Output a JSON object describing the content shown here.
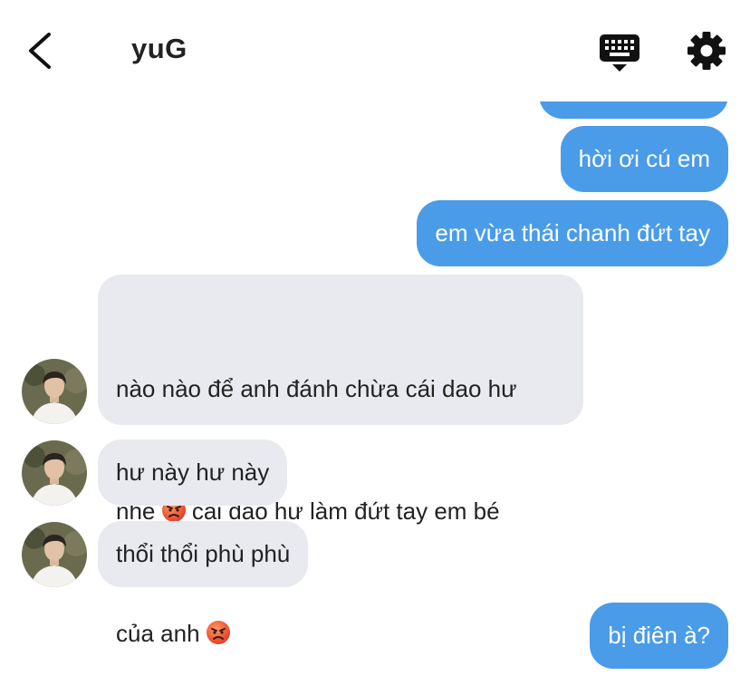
{
  "header": {
    "title": "yuG",
    "icons": [
      "back-chevron-icon",
      "keyboard-icon",
      "gear-icon"
    ]
  },
  "colors": {
    "outgoing": "#4a9ce8",
    "incoming": "#e8eaef",
    "text": "#222222"
  },
  "messages": [
    {
      "dir": "out",
      "text": ""
    },
    {
      "dir": "out",
      "text": "hời ơi cú em"
    },
    {
      "dir": "out",
      "text": "em vừa thái chanh đứt tay"
    },
    {
      "dir": "in",
      "line1": "nào nào để anh đánh chừa cái dao hư",
      "line2a": "nhé",
      "line2b": " cái dao hư làm đứt tay em bé",
      "line3": "của anh",
      "emoji": "angry-face"
    },
    {
      "dir": "in",
      "text": "hư này hư này"
    },
    {
      "dir": "in",
      "text": "thổi thổi phù phù"
    },
    {
      "dir": "out",
      "text": "bị điên à?"
    }
  ]
}
